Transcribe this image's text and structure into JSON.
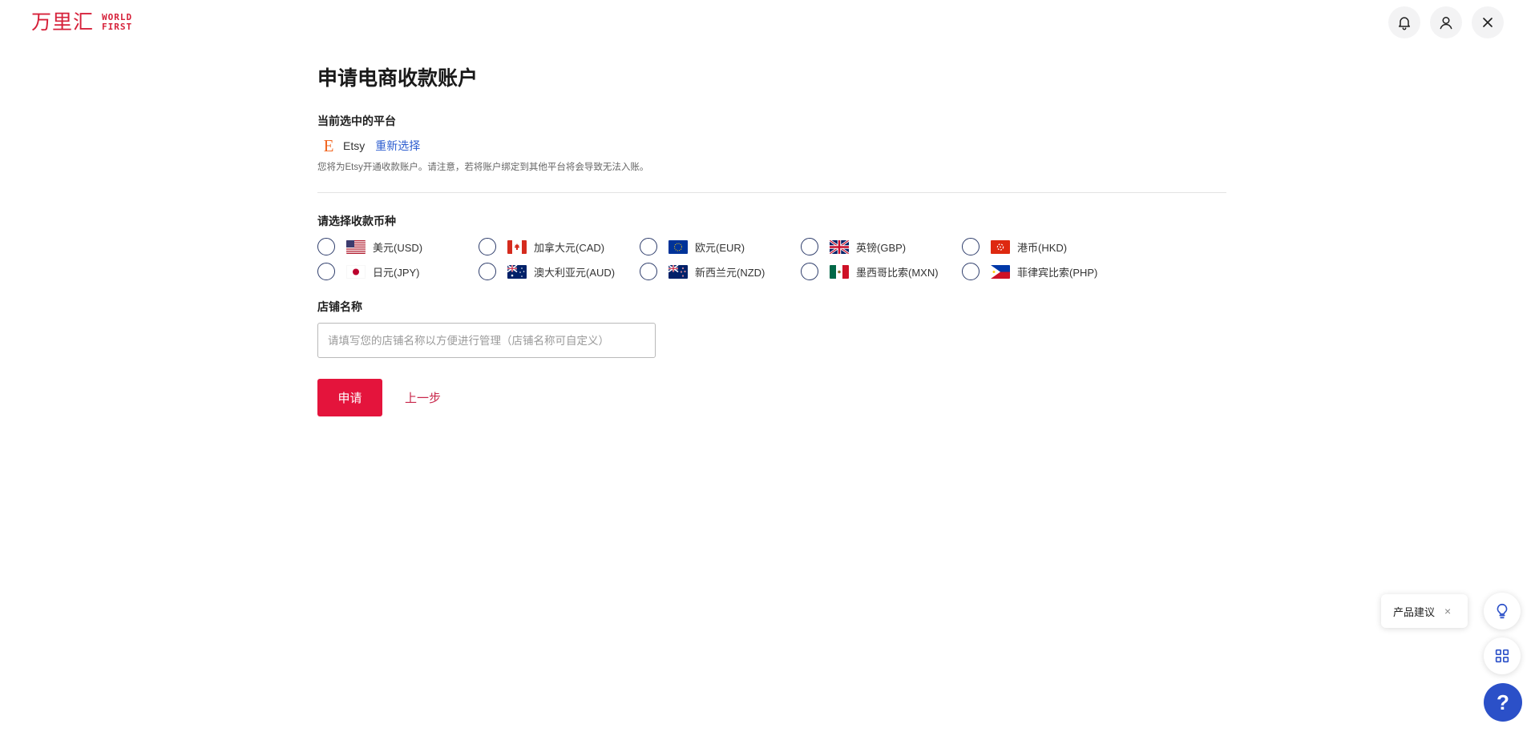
{
  "header": {
    "logo_cn": "万里汇",
    "logo_en_line1": "WORLD",
    "logo_en_line2": "FIRST",
    "icons": [
      "bell-icon",
      "user-icon",
      "close-icon"
    ]
  },
  "page": {
    "title": "申请电商收款账户"
  },
  "platform": {
    "label": "当前选中的平台",
    "logo_letter": "E",
    "name": "Etsy",
    "reselect": "重新选择",
    "note": "您将为Etsy开通收款账户。请注意，若将账户绑定到其他平台将会导致无法入账。"
  },
  "currency": {
    "label": "请选择收款币种",
    "options": [
      {
        "flag": "us",
        "label": "美元(USD)"
      },
      {
        "flag": "ca",
        "label": "加拿大元(CAD)"
      },
      {
        "flag": "eu",
        "label": "欧元(EUR)"
      },
      {
        "flag": "gb",
        "label": "英镑(GBP)"
      },
      {
        "flag": "hk",
        "label": "港币(HKD)"
      },
      {
        "flag": "jp",
        "label": "日元(JPY)"
      },
      {
        "flag": "au",
        "label": "澳大利亚元(AUD)"
      },
      {
        "flag": "nz",
        "label": "新西兰元(NZD)"
      },
      {
        "flag": "mx",
        "label": "墨西哥比索(MXN)"
      },
      {
        "flag": "ph",
        "label": "菲律宾比索(PHP)"
      }
    ]
  },
  "store": {
    "label": "店铺名称",
    "value": "",
    "placeholder": "请填写您的店铺名称以方便进行管理（店铺名称可自定义）"
  },
  "actions": {
    "apply": "申请",
    "back": "上一步"
  },
  "floating": {
    "suggestion": "产品建议",
    "suggestion_close": "×",
    "help": "?"
  },
  "colors": {
    "brand_red": "#e4143c",
    "link_blue": "#2f5fd0",
    "help_blue": "#2b50c8",
    "radio_border": "#2e3d6b"
  }
}
